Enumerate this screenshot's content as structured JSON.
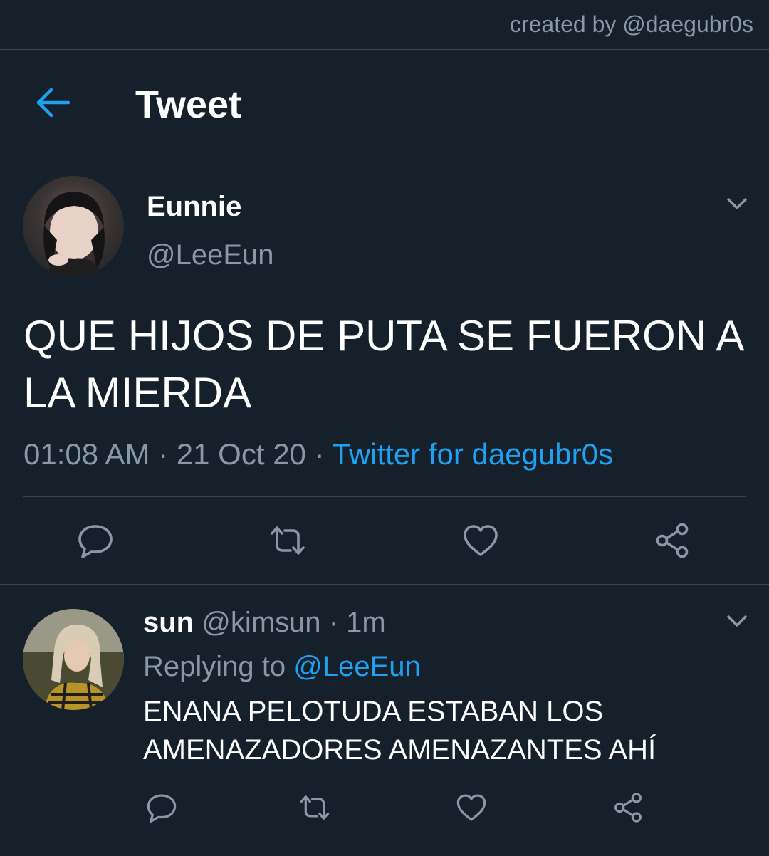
{
  "credit": "created by @daegubr0s",
  "header": {
    "title": "Tweet"
  },
  "tweet": {
    "name": "Eunnie",
    "handle": "@LeeEun",
    "text": "QUE HIJOS DE PUTA SE FUERON A LA MIERDA",
    "time": "01:08 AM",
    "date": "21 Oct 20",
    "source": "Twitter for daegubr0s"
  },
  "reply": {
    "name": "sun",
    "handle": "@kimsun",
    "age": "1m",
    "replying_label": "Replying to",
    "replying_to": "@LeeEun",
    "text": "ENANA PELOTUDA ESTABAN LOS AMENAZADORES AMENAZANTES AHÍ"
  },
  "colors": {
    "background": "#15202b",
    "accent": "#1da1f2",
    "secondary_text": "#8899a6",
    "divider": "#38444d"
  },
  "icons": [
    "back-arrow-icon",
    "chevron-down-icon",
    "reply-icon",
    "retweet-icon",
    "like-icon",
    "share-icon"
  ]
}
